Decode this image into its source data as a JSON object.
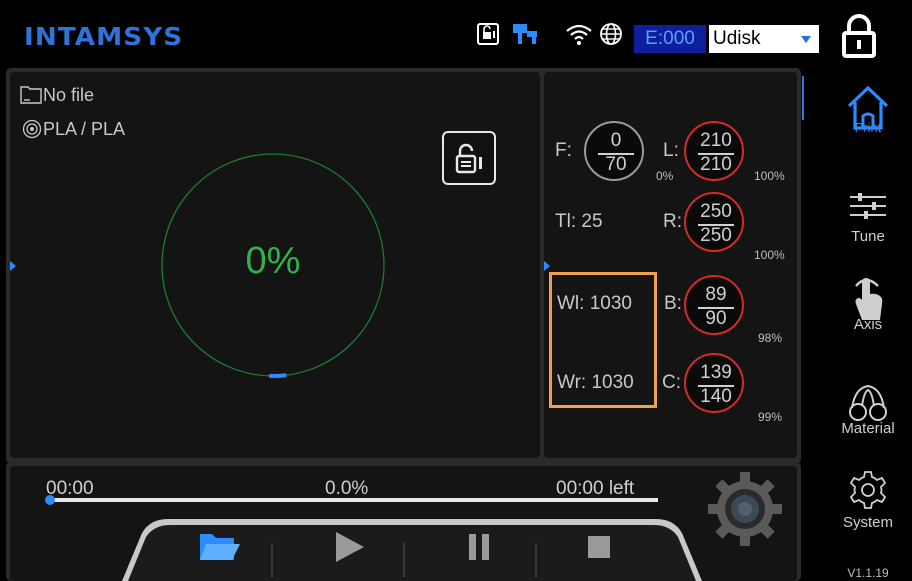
{
  "header": {
    "logo": "INTAMSYS",
    "error_code": "E:000",
    "storage_select": "Udisk",
    "icons": [
      "printer-lock-icon",
      "usb-connection-icon",
      "wifi-icon",
      "globe-icon",
      "lock-icon"
    ]
  },
  "file_panel": {
    "file_name": "No file",
    "material": "PLA / PLA",
    "progress_percent": "0%",
    "progress_value": 0.02
  },
  "temps": {
    "f_label": "F:",
    "f_current": "0",
    "f_target": "70",
    "l_label": "L:",
    "l_current": "210",
    "l_target": "210",
    "l_fan_min": "0%",
    "l_fan_max": "100%",
    "tl": "Tl: 25",
    "r_label": "R:",
    "r_current": "250",
    "r_target": "250",
    "r_pct": "100%",
    "wl": "Wl: 1030",
    "wr": "Wr: 1030",
    "b_label": "B:",
    "b_current": "89",
    "b_target": "90",
    "b_pct": "98%",
    "c_label": "C:",
    "c_current": "139",
    "c_target": "140",
    "c_pct": "99%"
  },
  "timeline": {
    "elapsed": "00:00",
    "percent": "0.0%",
    "remaining": "00:00 left"
  },
  "nav": {
    "print": "Print",
    "tune": "Tune",
    "axis": "Axis",
    "material": "Material",
    "system": "System",
    "version": "V1.1.19"
  },
  "colors": {
    "accent_blue": "#2b8bff",
    "progress_green": "#2fb24a",
    "gauge_red": "#d42a2a",
    "highlight_orange": "#f0a048"
  }
}
